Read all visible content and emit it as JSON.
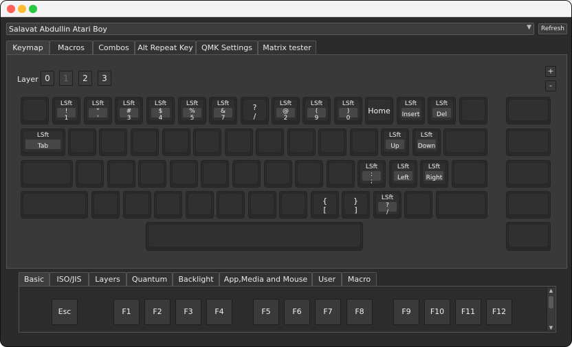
{
  "device": {
    "selected": "Salavat Abdullin Atari Boy",
    "refresh_label": "Refresh"
  },
  "tabs_top": [
    "Keymap",
    "Macros",
    "Combos",
    "Alt Repeat Key",
    "QMK Settings",
    "Matrix tester"
  ],
  "layer": {
    "label": "Layer",
    "buttons": [
      "0",
      "1",
      "2",
      "3"
    ],
    "active": "1",
    "plus": "+",
    "minus": "-"
  },
  "keys": {
    "r1": [
      {
        "top": "LSft",
        "lines": [
          "!",
          "1"
        ]
      },
      {
        "top": "LSft",
        "lines": [
          "\"",
          "'"
        ]
      },
      {
        "top": "LSft",
        "lines": [
          "#",
          "3"
        ]
      },
      {
        "top": "LSft",
        "lines": [
          "$",
          "4"
        ]
      },
      {
        "top": "LSft",
        "lines": [
          "%",
          "5"
        ]
      },
      {
        "top": "LSft",
        "lines": [
          "&",
          "7"
        ]
      },
      {
        "plain": [
          "?",
          "/"
        ]
      },
      {
        "top": "LSft",
        "lines": [
          "@",
          "2"
        ]
      },
      {
        "top": "LSft",
        "lines": [
          "(",
          "9"
        ]
      },
      {
        "top": "LSft",
        "lines": [
          ")",
          "0"
        ]
      },
      {
        "single_plain": "Home"
      },
      {
        "top": "LSft",
        "single": "Insert"
      },
      {
        "top": "LSft",
        "single": "Del"
      }
    ],
    "r2": [
      {
        "top": "LSft",
        "single": "Tab"
      },
      {
        "top": "LSft",
        "single": "Up"
      },
      {
        "top": "LSft",
        "single": "Down"
      }
    ],
    "r3": [
      {
        "top": "LSft",
        "lines": [
          ":",
          ";"
        ]
      },
      {
        "top": "LSft",
        "single": "Left"
      },
      {
        "top": "LSft",
        "single": "Right"
      }
    ],
    "r4": [
      {
        "plain": [
          "{",
          "["
        ]
      },
      {
        "plain": [
          "}",
          "]"
        ]
      },
      {
        "top": "LSft",
        "lines": [
          "?",
          "/"
        ]
      }
    ]
  },
  "tabs_bottom": [
    "Basic",
    "ISO/JIS",
    "Layers",
    "Quantum",
    "Backlight",
    "App,Media and Mouse",
    "User",
    "Macro"
  ],
  "basic_keys": [
    "Esc",
    "F1",
    "F2",
    "F3",
    "F4",
    "F5",
    "F6",
    "F7",
    "F8",
    "F9",
    "F10",
    "F11",
    "F12"
  ]
}
